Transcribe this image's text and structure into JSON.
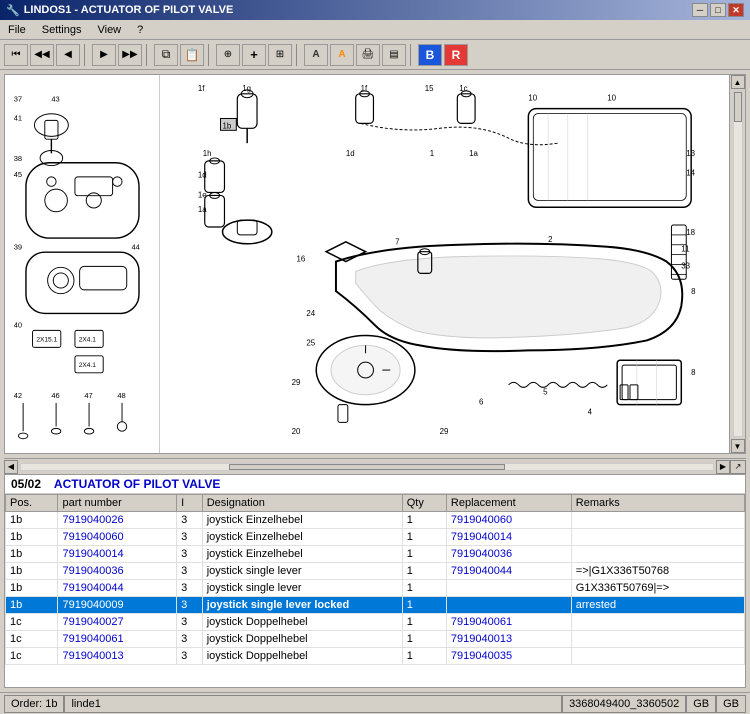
{
  "titlebar": {
    "title": "LINDOS1 - ACTUATOR OF PILOT VALVE",
    "icon": "🔧",
    "min_btn": "─",
    "max_btn": "□",
    "close_btn": "✕"
  },
  "menubar": {
    "items": [
      "File",
      "Settings",
      "View",
      "?"
    ]
  },
  "toolbar": {
    "buttons": [
      {
        "name": "nav-start",
        "icon": "⏮",
        "label": "Start"
      },
      {
        "name": "nav-prev-prev",
        "icon": "◀◀",
        "label": "Prev Prev"
      },
      {
        "name": "nav-prev",
        "icon": "◀",
        "label": "Prev"
      },
      {
        "separator": true
      },
      {
        "name": "nav-next",
        "icon": "▶",
        "label": "Next"
      },
      {
        "name": "nav-next-next",
        "icon": "▶▶",
        "label": "Next Next"
      },
      {
        "separator": true
      },
      {
        "name": "copy",
        "icon": "⧉",
        "label": "Copy"
      },
      {
        "name": "paste",
        "icon": "📋",
        "label": "Paste"
      },
      {
        "separator": true
      },
      {
        "name": "search",
        "icon": "🔍",
        "label": "Search"
      },
      {
        "name": "zoom-in",
        "icon": "+",
        "label": "Zoom In"
      },
      {
        "name": "zoom-out",
        "icon": "-",
        "label": "Zoom Out"
      },
      {
        "separator": true
      },
      {
        "name": "find",
        "icon": "A",
        "label": "Find"
      },
      {
        "name": "print",
        "icon": "🖨",
        "label": "Print"
      },
      {
        "separator": true
      },
      {
        "name": "green-box",
        "icon": "▤",
        "label": "List"
      },
      {
        "name": "blue-box",
        "icon": "■",
        "label": "Blue"
      },
      {
        "name": "red-box",
        "icon": "■",
        "label": "Red"
      }
    ]
  },
  "section": {
    "number": "05/02",
    "title": "ACTUATOR OF PILOT VALVE"
  },
  "table": {
    "columns": [
      "Pos.",
      "part number",
      "I",
      "Designation",
      "Qty",
      "Replacement",
      "Remarks"
    ],
    "rows": [
      {
        "pos": "1b",
        "part_number": "7919040026",
        "i": "3",
        "designation": "joystick Einzelhebel",
        "qty": "1",
        "replacement": "7919040060",
        "remarks": "",
        "selected": false
      },
      {
        "pos": "1b",
        "part_number": "7919040060",
        "i": "3",
        "designation": "joystick Einzelhebel",
        "qty": "1",
        "replacement": "7919040014",
        "remarks": "",
        "selected": false
      },
      {
        "pos": "1b",
        "part_number": "7919040014",
        "i": "3",
        "designation": "joystick Einzelhebel",
        "qty": "1",
        "replacement": "7919040036",
        "remarks": "",
        "selected": false
      },
      {
        "pos": "1b",
        "part_number": "7919040036",
        "i": "3",
        "designation": "joystick single lever",
        "qty": "1",
        "replacement": "7919040044",
        "remarks": "=>|G1X336T50768",
        "selected": false
      },
      {
        "pos": "1b",
        "part_number": "7919040044",
        "i": "3",
        "designation": "joystick single lever",
        "qty": "1",
        "replacement": "",
        "remarks": "G1X336T50769|=>",
        "selected": false
      },
      {
        "pos": "1b",
        "part_number": "7919040009",
        "i": "3",
        "designation": "joystick single lever locked",
        "qty": "1",
        "replacement": "",
        "remarks": "arrested",
        "selected": true
      },
      {
        "pos": "1c",
        "part_number": "7919040027",
        "i": "3",
        "designation": "joystick Doppelhebel",
        "qty": "1",
        "replacement": "7919040061",
        "remarks": "",
        "selected": false
      },
      {
        "pos": "1c",
        "part_number": "7919040061",
        "i": "3",
        "designation": "joystick Doppelhebel",
        "qty": "1",
        "replacement": "7919040013",
        "remarks": "",
        "selected": false
      },
      {
        "pos": "1c",
        "part_number": "7919040013",
        "i": "3",
        "designation": "ioystick Doppelhebel",
        "qty": "1",
        "replacement": "7919040035",
        "remarks": "",
        "selected": false
      }
    ]
  },
  "statusbar": {
    "order_label": "Order: 1b",
    "user": "linde1",
    "code": "3368049400_3360502",
    "gb1": "GB",
    "gb2": "GB"
  },
  "scrollbar": {
    "right_arrow": "▲",
    "left_arrow": "▼",
    "h_left": "◀",
    "h_right": "▶"
  }
}
